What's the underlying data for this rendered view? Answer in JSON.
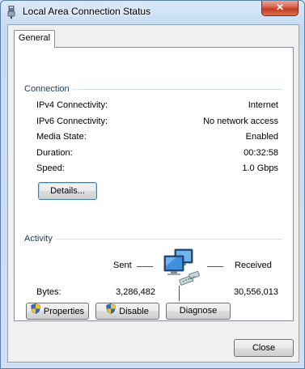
{
  "window": {
    "title": "Local Area Connection Status",
    "close_label": "✕"
  },
  "tabs": [
    {
      "label": "General"
    }
  ],
  "connection": {
    "group_label": "Connection",
    "rows": [
      {
        "label": "IPv4 Connectivity:",
        "value": "Internet"
      },
      {
        "label": "IPv6 Connectivity:",
        "value": "No network access"
      },
      {
        "label": "Media State:",
        "value": "Enabled"
      },
      {
        "label": "Duration:",
        "value": "00:32:58"
      },
      {
        "label": "Speed:",
        "value": "1.0 Gbps"
      }
    ],
    "details_button": "Details..."
  },
  "activity": {
    "group_label": "Activity",
    "sent_label": "Sent",
    "received_label": "Received",
    "bytes_label": "Bytes:",
    "bytes_sent": "3,286,482",
    "bytes_received": "30,556,013"
  },
  "buttons": {
    "properties": "Properties",
    "disable": "Disable",
    "diagnose": "Diagnose",
    "close": "Close"
  },
  "icons": {
    "window": "network-adapter-icon",
    "network": "network-computers-icon",
    "shield": "uac-shield-icon"
  },
  "colors": {
    "title_gradient_top": "#dbe9f8",
    "close_button": "#c43b22",
    "group_label": "#1e395b",
    "panel": "#ffffff"
  }
}
